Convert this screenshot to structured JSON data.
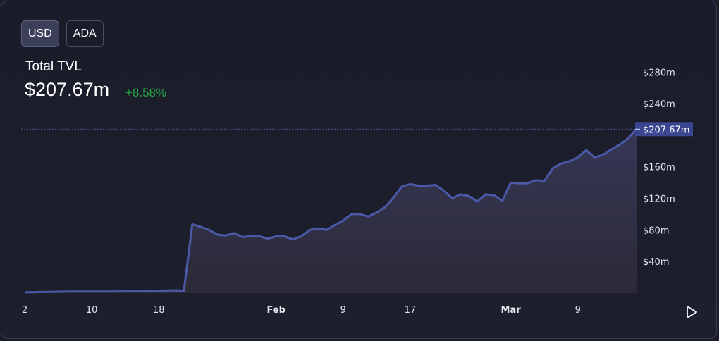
{
  "currency_toggle": {
    "options": [
      "USD",
      "ADA"
    ],
    "selected": "USD"
  },
  "summary": {
    "title": "Total TVL",
    "value": "$207.67m",
    "change": "+8.58%"
  },
  "colors": {
    "line": "#4a5aa8",
    "change_positive": "#27a644",
    "label_bg": "#3a4790",
    "background": "#1c1d2b"
  },
  "icons": {
    "play": "play-icon"
  },
  "chart_data": {
    "type": "area",
    "title": "",
    "xlabel": "",
    "ylabel": "",
    "ylim": [
      0,
      300
    ],
    "y_ticks": [
      40,
      80,
      120,
      160,
      240,
      280
    ],
    "y_tick_labels": [
      "$40m",
      "$80m",
      "$120m",
      "$160m",
      "$240m",
      "$280m"
    ],
    "x_ticks": [
      {
        "day": 2,
        "label": "2",
        "bold": false
      },
      {
        "day": 10,
        "label": "10",
        "bold": false
      },
      {
        "day": 18,
        "label": "18",
        "bold": false
      },
      {
        "day": 32,
        "label": "Feb",
        "bold": true
      },
      {
        "day": 40,
        "label": "9",
        "bold": false
      },
      {
        "day": 48,
        "label": "17",
        "bold": false
      },
      {
        "day": 60,
        "label": "Mar",
        "bold": true
      },
      {
        "day": 68,
        "label": "9",
        "bold": false
      }
    ],
    "current_value": 207.67,
    "current_label": "$207.67m",
    "series": [
      {
        "x": [
          2,
          3,
          4,
          5,
          6,
          7,
          8,
          9,
          10,
          11,
          12,
          13,
          14,
          15,
          16,
          17,
          18,
          19,
          20,
          21,
          22,
          23,
          24,
          25,
          26,
          27,
          28,
          29,
          30,
          31,
          32,
          33,
          34,
          35,
          36,
          37,
          38,
          39,
          40,
          41,
          42,
          43,
          44,
          45,
          46,
          47,
          48,
          49,
          50,
          51,
          52,
          53,
          54,
          55,
          56,
          57,
          58,
          59,
          60,
          61,
          62,
          63,
          64,
          65,
          66,
          67,
          68,
          69,
          70,
          71,
          72,
          73,
          74,
          75
        ],
        "y": [
          1,
          1.2,
          1.4,
          1.6,
          1.8,
          2,
          2,
          2,
          2,
          2,
          2,
          2.1,
          2.1,
          2.2,
          2.2,
          2.3,
          2.8,
          3.2,
          3.5,
          3.1,
          87,
          84,
          80,
          74,
          73,
          76,
          71,
          72,
          72,
          69,
          72,
          72,
          68,
          72,
          80,
          82,
          80,
          86,
          92,
          100,
          100,
          97,
          102,
          109,
          121,
          135,
          138,
          136,
          136,
          137,
          130,
          120,
          125,
          123,
          116,
          125,
          124,
          117,
          140,
          139,
          139,
          143,
          142,
          158,
          164,
          167,
          172,
          181,
          172,
          175,
          182,
          188,
          196,
          208
        ]
      }
    ]
  }
}
